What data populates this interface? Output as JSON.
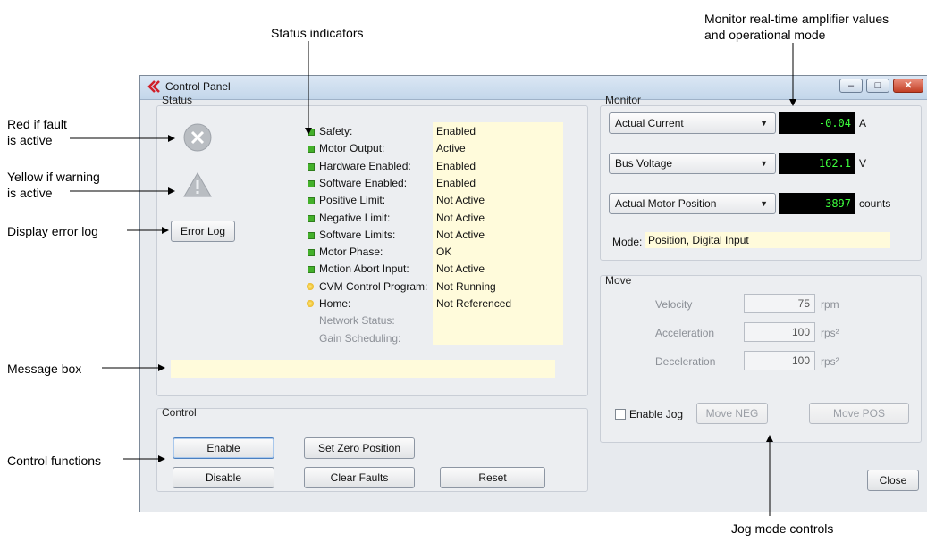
{
  "annotations": {
    "status_indicators": "Status indicators",
    "monitor_line1": "Monitor real-time amplifier values",
    "monitor_line2": "and operational  mode",
    "red_fault_line1": "Red if fault",
    "red_fault_line2": "is active",
    "yellow_warning_line1": "Yellow if warning",
    "yellow_warning_line2": "is active",
    "display_error_log": "Display error log",
    "message_box": "Message box",
    "control_functions": "Control functions",
    "jog_mode_controls": "Jog mode controls"
  },
  "window": {
    "title": "Control Panel",
    "minimize_glyph": "–",
    "maximize_glyph": "□",
    "close_glyph": "✕"
  },
  "status": {
    "group_title": "Status",
    "fault_icon": "error-circle-x-icon",
    "warning_icon": "warning-triangle-icon",
    "error_log_label": "Error Log",
    "message_text": "",
    "items": [
      {
        "label": "Safety:",
        "value": "Enabled",
        "indicator": "green"
      },
      {
        "label": "Motor Output:",
        "value": "Active",
        "indicator": "green"
      },
      {
        "label": "Hardware Enabled:",
        "value": "Enabled",
        "indicator": "green"
      },
      {
        "label": "Software Enabled:",
        "value": "Enabled",
        "indicator": "green"
      },
      {
        "label": "Positive Limit:",
        "value": "Not Active",
        "indicator": "green"
      },
      {
        "label": "Negative Limit:",
        "value": "Not Active",
        "indicator": "green"
      },
      {
        "label": "Software Limits:",
        "value": "Not Active",
        "indicator": "green"
      },
      {
        "label": "Motor Phase:",
        "value": "OK",
        "indicator": "green"
      },
      {
        "label": "Motion Abort Input:",
        "value": "Not Active",
        "indicator": "green"
      },
      {
        "label": "CVM Control Program:",
        "value": "Not Running",
        "indicator": "yellow"
      },
      {
        "label": "Home:",
        "value": "Not Referenced",
        "indicator": "yellow"
      },
      {
        "label": "Network Status:",
        "value": "",
        "indicator": "none"
      },
      {
        "label": "Gain Scheduling:",
        "value": "",
        "indicator": "none"
      }
    ]
  },
  "control": {
    "group_title": "Control",
    "enable": "Enable",
    "disable": "Disable",
    "set_zero_position": "Set Zero Position",
    "clear_faults": "Clear Faults",
    "reset": "Reset"
  },
  "monitor": {
    "group_title": "Monitor",
    "rows": [
      {
        "select": "Actual Current",
        "value": "-0.04",
        "unit": "A"
      },
      {
        "select": "Bus Voltage",
        "value": "162.1",
        "unit": "V"
      },
      {
        "select": "Actual Motor Position",
        "value": "3897",
        "unit": "counts"
      }
    ],
    "mode_label": "Mode:",
    "mode_value": "Position, Digital Input"
  },
  "move": {
    "group_title": "Move",
    "velocity_label": "Velocity",
    "velocity_value": "75",
    "velocity_unit": "rpm",
    "acceleration_label": "Acceleration",
    "acceleration_value": "100",
    "acceleration_unit": "rps²",
    "deceleration_label": "Deceleration",
    "deceleration_value": "100",
    "deceleration_unit": "rps²",
    "enable_jog_label": "Enable Jog",
    "enable_jog_checked": false,
    "move_neg": "Move NEG",
    "move_pos": "Move POS"
  },
  "close_label": "Close",
  "colors": {
    "led_green": "#43b02a",
    "led_yellow": "#e2a400",
    "value_panel": "#fffbdb",
    "lcd_text": "#3dff3d",
    "lcd_background": "#000000"
  }
}
